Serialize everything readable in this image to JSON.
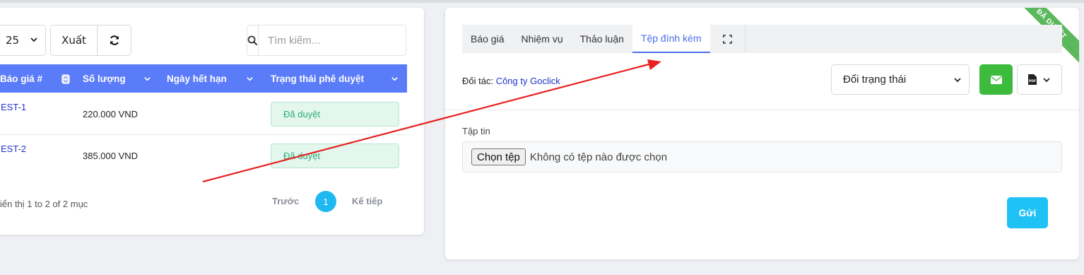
{
  "left": {
    "page_size": "25",
    "export_label": "Xuất",
    "search_placeholder": "Tìm kiếm...",
    "columns": [
      "Báo giá #",
      "Số lượng",
      "Ngày hết hạn",
      "Trạng thái phê duyệt"
    ],
    "rows": [
      {
        "code": "EST-1",
        "amount": "220.000 VND",
        "status": "Đã duyệt"
      },
      {
        "code": "EST-2",
        "amount": "385.000 VND",
        "status": "Đã duyệt"
      }
    ],
    "info": "iển thị 1 to 2 of 2 mục",
    "prev_label": "Trước",
    "page_number": "1",
    "next_label": "Kế tiếp"
  },
  "right": {
    "tabs": [
      "Báo giá",
      "Nhiệm vụ",
      "Thảo luận",
      "Tệp đính kèm"
    ],
    "active_tab": "Tệp đính kèm",
    "ribbon": "ĐÃ DUYỆT",
    "partner_label": "Đối tác: ",
    "partner_name": "Công ty Goclick",
    "status_select": "Đổi trạng thái",
    "file_label": "Tập tin",
    "choose_file": "Chọn tệp",
    "no_file": "Không có tệp nào được chọn",
    "send_label": "Gửi"
  },
  "colors": {
    "table_header": "#5b7cf8",
    "approved_badge": "#2eab72",
    "email_button": "#3dbb3d",
    "send_button": "#1fc2f5",
    "ribbon": "#5cb85c",
    "annotation_arrow": "#e8201e"
  }
}
